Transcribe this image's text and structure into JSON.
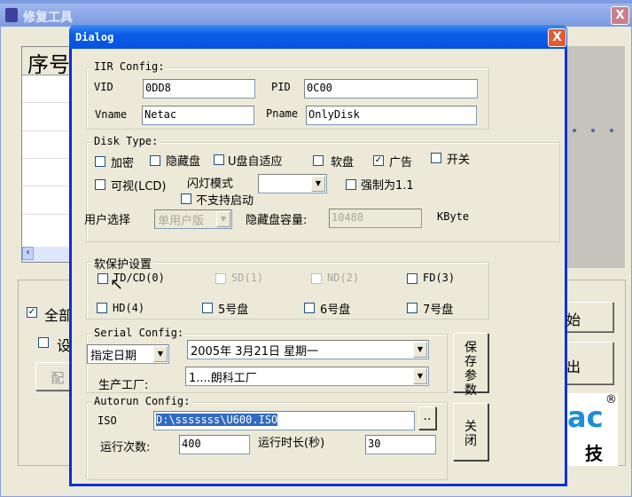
{
  "background_window": {
    "title": "修复工具",
    "close": "X",
    "list_header": "序号",
    "checkbox_all": "全部",
    "checkbox_set": "设",
    "button_partial": "配",
    "button_start_partial": "始",
    "button_exit_partial": "出",
    "logo_text": "ac",
    "logo_cn": "技",
    "logo_reg": "®"
  },
  "dialog": {
    "title": "Dialog",
    "close": "X",
    "iir": {
      "legend": "IIR Config:",
      "vid_label": "VID",
      "vid": "0DD8",
      "pid_label": "PID",
      "pid": "0C00",
      "vname_label": "Vname",
      "vname": "Netac",
      "pname_label": "Pname",
      "pname": "OnlyDisk"
    },
    "disk": {
      "legend": "Disk Type:",
      "encrypt": "加密",
      "hidden": "隐藏盘",
      "uadapt": "U盘自适应",
      "floppy": "软盘",
      "ad": "广告",
      "ad_checked": true,
      "switch": "开关",
      "lcd": "可视(LCD)",
      "led_mode_label": "闪灯模式",
      "led_mode": "",
      "force11": "强制为1.1",
      "no_boot": "不支持启动",
      "user_label": "用户选择",
      "user_value": "单用户版",
      "hidden_cap_label": "隐藏盘容量:",
      "hidden_cap": "10480",
      "unit": "KByte"
    },
    "protect": {
      "legend": "软保护设置",
      "items": [
        "TD/CD(0)",
        "SD(1)",
        "ND(2)",
        "FD(3)",
        "HD(4)",
        "5号盘",
        "6号盘",
        "7号盘"
      ]
    },
    "serial": {
      "legend": "Serial Config:",
      "mode": "指定日期",
      "date": "2005年  3月21日  星期一",
      "factory_label": "生产工厂:",
      "factory": "1....朗科工厂"
    },
    "save_button": "保存参数",
    "autorun": {
      "legend": "Autorun Config:",
      "iso_label": "ISO",
      "iso": "D:\\sssssss\\U600.ISO",
      "browse": "..",
      "runs_label": "运行次数:",
      "runs": "400",
      "duration_label": "运行时长(秒)",
      "duration": "30"
    },
    "close_button": "关闭"
  }
}
